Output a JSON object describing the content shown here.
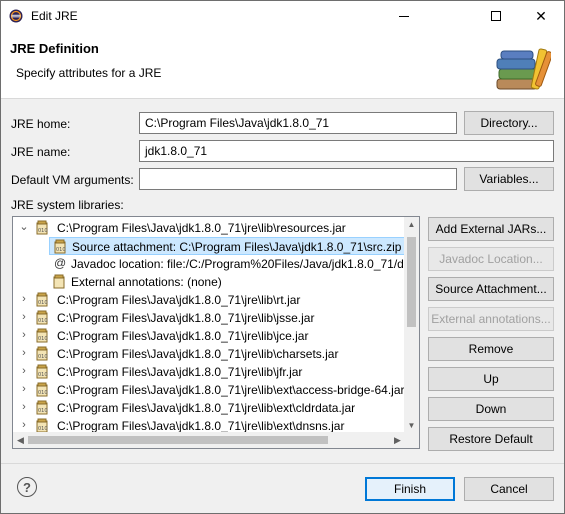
{
  "window": {
    "title": "Edit JRE",
    "minimize_glyph": "",
    "close_glyph": "✕"
  },
  "header": {
    "title": "JRE Definition",
    "subtitle": "Specify attributes for a JRE",
    "icon": "jre-books-icon"
  },
  "form": {
    "jre_home_label": "JRE home:",
    "jre_home_value": "C:\\Program Files\\Java\\jdk1.8.0_71",
    "directory_button": "Directory...",
    "jre_name_label": "JRE name:",
    "jre_name_value": "jdk1.8.0_71",
    "vm_args_label": "Default VM arguments:",
    "vm_args_value": "",
    "variables_button": "Variables...",
    "libraries_label": "JRE system libraries:"
  },
  "tree": {
    "expanded_twisty": "⌄",
    "collapsed_twisty": "›",
    "root_expanded": "C:\\Program Files\\Java\\jdk1.8.0_71\\jre\\lib\\resources.jar",
    "children": [
      {
        "icon": "source-attachment-icon",
        "text": "Source attachment: C:\\Program Files\\Java\\jdk1.8.0_71\\src.zip"
      },
      {
        "icon": "javadoc-icon",
        "glyph": "@",
        "text": "Javadoc location: file:/C:/Program%20Files/Java/jdk1.8.0_71/d"
      },
      {
        "icon": "external-annotations-icon",
        "text": "External annotations: (none)"
      }
    ],
    "jars": [
      "C:\\Program Files\\Java\\jdk1.8.0_71\\jre\\lib\\rt.jar",
      "C:\\Program Files\\Java\\jdk1.8.0_71\\jre\\lib\\jsse.jar",
      "C:\\Program Files\\Java\\jdk1.8.0_71\\jre\\lib\\jce.jar",
      "C:\\Program Files\\Java\\jdk1.8.0_71\\jre\\lib\\charsets.jar",
      "C:\\Program Files\\Java\\jdk1.8.0_71\\jre\\lib\\jfr.jar",
      "C:\\Program Files\\Java\\jdk1.8.0_71\\jre\\lib\\ext\\access-bridge-64.jar",
      "C:\\Program Files\\Java\\jdk1.8.0_71\\jre\\lib\\ext\\cldrdata.jar",
      "C:\\Program Files\\Java\\jdk1.8.0_71\\jre\\lib\\ext\\dnsns.jar"
    ],
    "scroll_up": "▲",
    "scroll_down": "▼",
    "scroll_left": "◀",
    "scroll_right": "▶"
  },
  "side_buttons": {
    "add_external_jars": "Add External JARs...",
    "javadoc_location": "Javadoc Location...",
    "source_attachment": "Source Attachment...",
    "external_annotations": "External annotations...",
    "remove": "Remove",
    "up": "Up",
    "down": "Down",
    "restore_default": "Restore Default"
  },
  "footer": {
    "help": "?",
    "finish": "Finish",
    "cancel": "Cancel"
  },
  "colors": {
    "selection": "#cce8ff",
    "default_button_border": "#0078d7"
  }
}
